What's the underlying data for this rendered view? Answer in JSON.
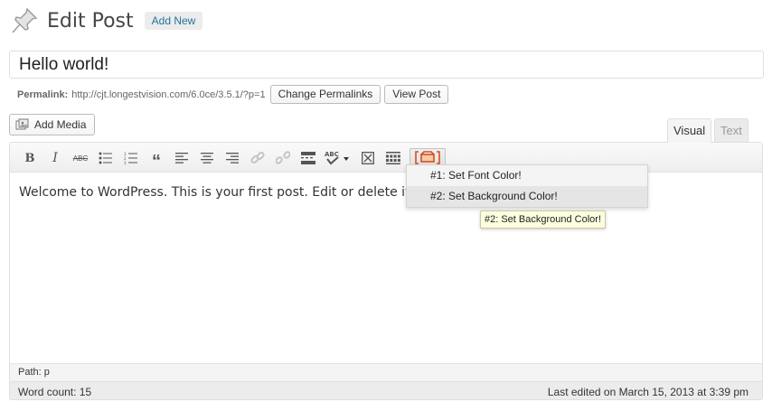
{
  "header": {
    "title": "Edit Post",
    "add_new": "Add New",
    "icon": "pushpin-icon"
  },
  "post": {
    "title": "Hello world!"
  },
  "permalink": {
    "label": "Permalink:",
    "url": "http://cjt.longestvision.com/6.0ce/3.5.1/?p=1",
    "change_button": "Change Permalinks",
    "view_button": "View Post"
  },
  "media": {
    "add_media": "Add Media"
  },
  "editor_tabs": {
    "visual": "Visual",
    "text": "Text"
  },
  "toolbar": {
    "bold": "B",
    "italic": "I",
    "strikethrough": "ABC",
    "icons": [
      "bold-icon",
      "italic-icon",
      "strikethrough-icon",
      "bullet-list-icon",
      "numbered-list-icon",
      "blockquote-icon",
      "align-left-icon",
      "align-center-icon",
      "align-right-icon",
      "link-icon",
      "unlink-icon",
      "insert-more-icon",
      "spellcheck-icon",
      "fullscreen-icon",
      "kitchen-sink-icon",
      "plugin-menu-icon"
    ]
  },
  "content": {
    "text": "Welcome to WordPress. This is your first post. Edit or delete it, th"
  },
  "dropdown": {
    "items": [
      "#1: Set Font Color!",
      "#2: Set Background Color!"
    ],
    "hovered_index": 1
  },
  "tooltip": {
    "text": "#2: Set Background Color!"
  },
  "footer": {
    "path": "Path: p",
    "word_count": "Word count: 15",
    "last_edited": "Last edited on March 15, 2013 at 3:39 pm"
  },
  "colors": {
    "link": "#21759b",
    "tooltip_bg": "#ffffe0",
    "plugin_icon": "#d54e21"
  }
}
